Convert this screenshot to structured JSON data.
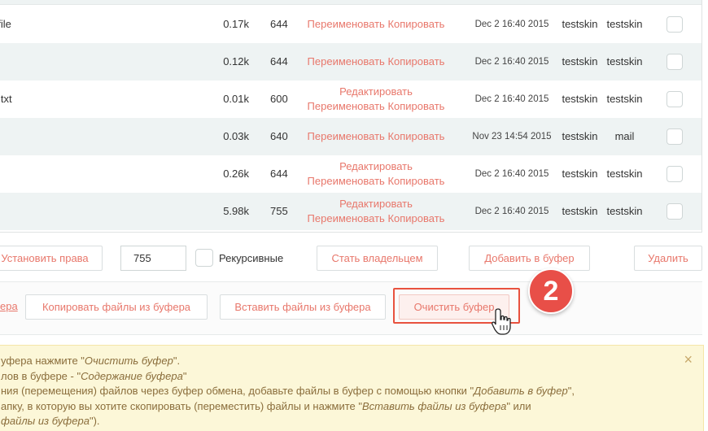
{
  "files": [
    {
      "name": "ofile",
      "size": "0.17k",
      "perm": "644",
      "actions": [
        "Переименовать Копировать"
      ],
      "date": "Dec 2 16:40 2015",
      "owner": "testskin",
      "group": "testskin"
    },
    {
      "name": "",
      "size": "0.12k",
      "perm": "644",
      "actions": [
        "Переименовать Копировать"
      ],
      "date": "Dec 2 16:40 2015",
      "owner": "testskin",
      "group": "testskin"
    },
    {
      "name": "d.txt",
      "size": "0.01k",
      "perm": "600",
      "actions": [
        "Редактировать",
        "Переименовать Копировать"
      ],
      "date": "Dec 2 16:40 2015",
      "owner": "testskin",
      "group": "testskin"
    },
    {
      "name": "",
      "size": "0.03k",
      "perm": "640",
      "actions": [
        "Переименовать Копировать"
      ],
      "date": "Nov 23 14:54 2015",
      "owner": "testskin",
      "group": "mail"
    },
    {
      "name": "",
      "size": "0.26k",
      "perm": "644",
      "actions": [
        "Редактировать",
        "Переименовать Копировать"
      ],
      "date": "Dec 2 16:40 2015",
      "owner": "testskin",
      "group": "testskin"
    },
    {
      "name": "",
      "size": "5.98k",
      "perm": "755",
      "actions": [
        "Редактировать",
        "Переименовать Копировать"
      ],
      "date": "Dec 2 16:40 2015",
      "owner": "testskin",
      "group": "testskin"
    }
  ],
  "toolbar1": {
    "set_perms": "Установить права",
    "perm_value": "755",
    "recursive_label": "Рекурсивные",
    "become_owner": "Стать владельцем",
    "add_to_buffer": "Добавить в буфер",
    "delete": "Удалить"
  },
  "toolbar2": {
    "clipboard_link": "ера",
    "copy_from_buffer": "Копировать файлы из буфера",
    "paste_from_buffer": "Вставить файлы из буфера",
    "clear_buffer": "Очистить буфер"
  },
  "step_badge": "2",
  "alert": {
    "line1_a": "уфера нажмите \"",
    "line1_em": "Очистить буфер",
    "line1_b": "\".",
    "line2_a": "лов в буфере - \"",
    "line2_em": "Содержание буфера",
    "line2_b": "\"",
    "line3_a": "ния (перемещения) файлов через буфер обмена, добавьте файлы в буфер с помощью кнопки \"",
    "line3_em": "Добавить в буфер",
    "line3_b": "\",",
    "line4_a": "апку, в которую вы хотите скопировать (переместить) файлы и нажмите \"",
    "line4_em": "Вставить файлы из буфера",
    "line4_b": "\" или",
    "line5_em": "файлы из буфера",
    "line5_b": "\").",
    "close": "×"
  },
  "colors": {
    "accent": "#e8776b",
    "highlight": "#e8523f",
    "badge": "#e84f48",
    "alert_bg": "#fcf7d8",
    "row_alt": "#eef3f3"
  }
}
